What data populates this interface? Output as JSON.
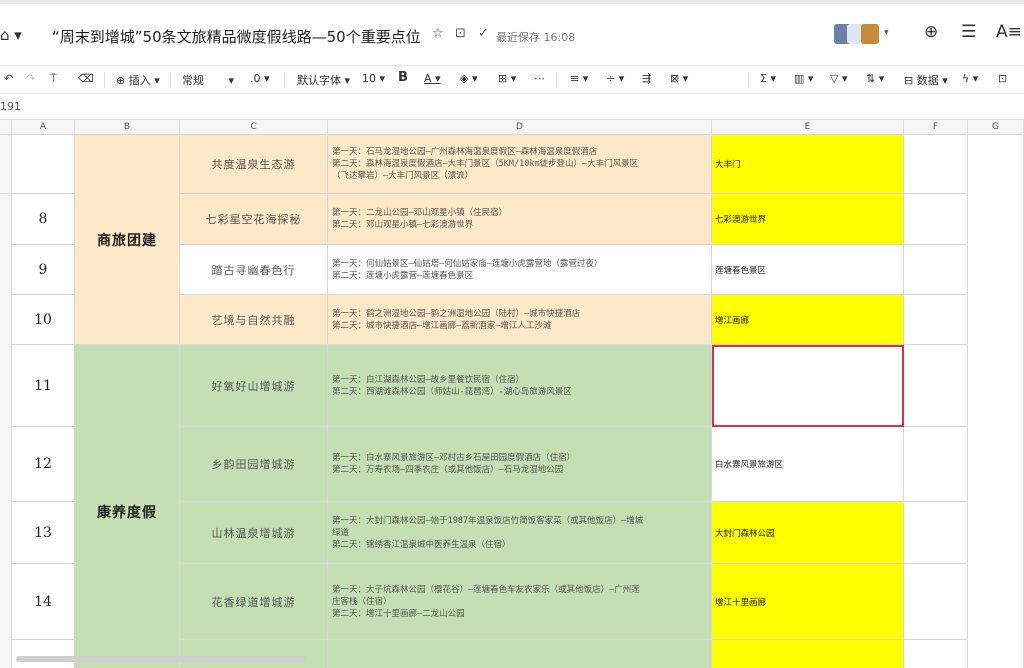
{
  "header": {
    "title": "“周末到增城”50条文旅精品微度假线路—50个重要点位",
    "saved": "最近保存 16:08"
  },
  "toolbar": {
    "insert": "插入",
    "format": "常规",
    "decimal": ".0",
    "font": "默认字体",
    "size": "10",
    "bold": "B",
    "data": "数据"
  },
  "formula": {
    "cellref": "191"
  },
  "columns": [
    "A",
    "B",
    "C",
    "D",
    "E",
    "F",
    "G"
  ],
  "categories": {
    "business": "商旅团建",
    "health": "康养度假"
  },
  "rows": [
    {
      "num": "",
      "name": "共度温泉生态游",
      "route": [
        "第一天：石马龙湿地公园—广州森林海温泉度假区—森林海温泉度假酒店",
        "第二天：森林海温泉度假酒店—大丰门景区（5KM/10km徒步登山）—大丰门风景区",
        "（飞达攀岩）—大丰门风景区（漂流）"
      ],
      "spot": "大丰门"
    },
    {
      "num": "8",
      "name": "七彩星空花海探秘",
      "route": [
        "第一天：二龙山公园—邓山观星小镇（住民宿）",
        "第二天：邓山观星小镇—七彩澳游世界"
      ],
      "spot": "七彩澳游世界"
    },
    {
      "num": "9",
      "name": "踏古寻幽春色行",
      "route": [
        "第一天：何仙姑景区—仙姑塔—何仙姑家庙—莲塘小虎露营地（露营过夜）",
        "第二天：莲塘小虎露营—莲塘春色景区"
      ],
      "spot": "莲塘春色景区"
    },
    {
      "num": "10",
      "name": "艺境与自然共融",
      "route": [
        "第一天：鹤之洲湿地公园—鹤之洲湿地公园（陆村）—城市快捷酒店",
        "第二天：城市快捷酒店—增江画廊—荔新酒家—增江人工沙滩"
      ],
      "spot": "增江画廊"
    },
    {
      "num": "11",
      "name": "好氧好山增城游",
      "route": [
        "第一天：白江湖森林公园—故乡里餐饮民宿（住宿）",
        "第二天：西湖滩森林公园（师姑山-琵琶湾）-湖心岛旅游风景区"
      ],
      "spot": ""
    },
    {
      "num": "12",
      "name": "乡韵田园增城游",
      "route": [
        "第一天：白水寨风景旅游区—邓村古乡石屋田园度假酒店（住宿）",
        "第二天：万寿农场—四季农庄（或其他饭店）—石马龙湿地公园"
      ],
      "spot": "白水寨风景旅游区"
    },
    {
      "num": "13",
      "name": "山林温泉增城游",
      "route": [
        "第一天：大封门森林公园—始于1987年温泉饭店竹简饭客家菜（或其他饭店）—增城",
        "绿道",
        "第二天：锦绣香江温泉城中医养生温泉（住宿）"
      ],
      "spot": "大封门森林公园"
    },
    {
      "num": "14",
      "name": "花香绿道增城游",
      "route": [
        "第一天：大子坑森林公园（樱花谷）—莲塘春色车友农家乐（或其他饭店）—广州莲",
        "庄客栈（住宿）",
        "第二天：增江十里画廊—二龙山公园"
      ],
      "spot": "增江十里画廊"
    }
  ]
}
